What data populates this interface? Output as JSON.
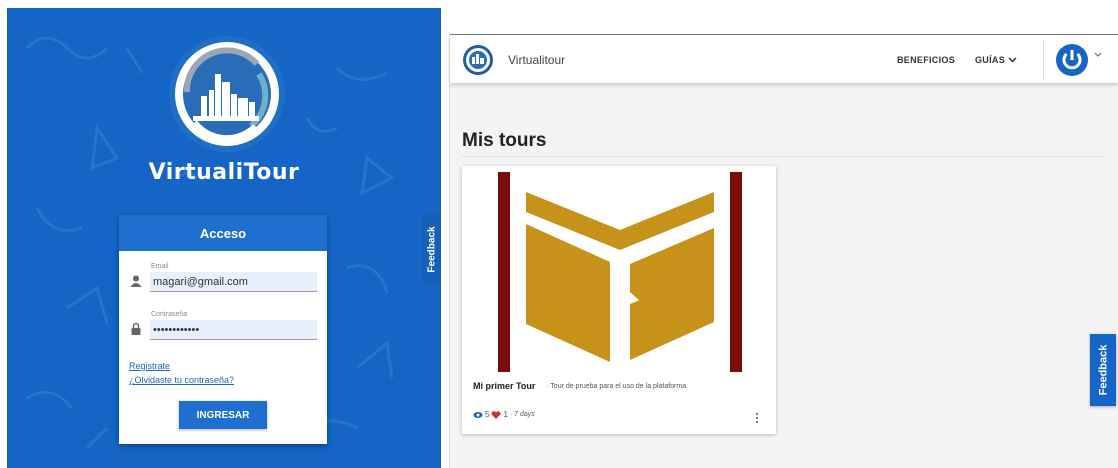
{
  "colors": {
    "brand_blue": "#1565c6",
    "card_header_blue": "#1e6fd0",
    "book_gold": "#c6921a",
    "book_bar": "#7a0d0d"
  },
  "login": {
    "brand": "VirtualiTour",
    "card_title": "Acceso",
    "email_label": "Email",
    "email_value": "magari@gmail.com",
    "password_label": "Contraseña",
    "password_value": "passwordpass",
    "register_link": "Registrate",
    "forgot_link": "¿Olvidaste tu contraseña?",
    "submit_label": "INGRESAR",
    "feedback_label": "Feedback"
  },
  "app": {
    "name": "Virtualitour",
    "nav": {
      "beneficios": "BENEFICIOS",
      "guias": "GUÍAS"
    },
    "page_title": "Mis tours",
    "tour": {
      "name": "Mi primer Tour",
      "separator": "·",
      "description": "Tour de prueba para el uso de la plataforma.",
      "views": "5",
      "likes": "1",
      "age": "· 7 days"
    },
    "feedback_label": "Feedback"
  },
  "icons": [
    "person-icon",
    "lock-icon",
    "eye-icon",
    "heart-icon",
    "more-vert-icon",
    "chevron-down-icon",
    "power-icon",
    "app-logo-icon"
  ]
}
